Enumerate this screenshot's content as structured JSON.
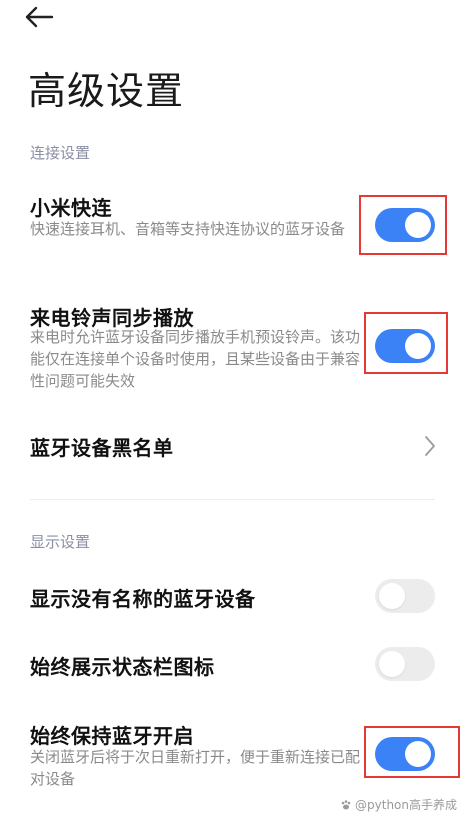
{
  "header": {
    "back_icon": "back-arrow-icon",
    "title": "高级设置"
  },
  "sections": {
    "connection": {
      "header": "连接设置",
      "items": {
        "mi_quick_connect": {
          "title": "小米快连",
          "description": "快速连接耳机、音箱等支持快连协议的蓝牙设备",
          "enabled": true
        },
        "ringtone_sync": {
          "title": "来电铃声同步播放",
          "description": "来电时允许蓝牙设备同步播放手机预设铃声。该功能仅在连接单个设备时使用，且某些设备由于兼容性问题可能失效",
          "enabled": true
        },
        "blacklist": {
          "title": "蓝牙设备黑名单",
          "icon": "chevron-right-icon"
        }
      }
    },
    "display": {
      "header": "显示设置",
      "items": {
        "show_unnamed": {
          "title": "显示没有名称的蓝牙设备",
          "enabled": false
        },
        "status_bar_icon": {
          "title": "始终展示状态栏图标",
          "enabled": false
        },
        "keep_on": {
          "title": "始终保持蓝牙开启",
          "description": "关闭蓝牙后将于次日重新打开，便于重新连接已配对设备",
          "enabled": true
        }
      }
    }
  },
  "watermark": {
    "text": "@python高手养成"
  },
  "colors": {
    "accent": "#3b82f6",
    "toggle_off": "#ececec",
    "highlight": "#e53935",
    "section_header": "#8a8fa3"
  }
}
